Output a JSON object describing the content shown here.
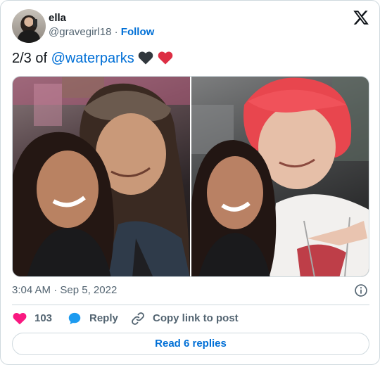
{
  "author": {
    "name": "ella",
    "handle": "@gravegirl18",
    "separator": "·",
    "follow_label": "Follow"
  },
  "brand_icon": "x-logo-icon",
  "tweet": {
    "text_prefix": "2/3 of ",
    "mention": "@waterparks",
    "emojis": [
      "black-heart-icon",
      "red-heart-icon"
    ]
  },
  "media": {
    "photos": [
      {
        "description_icon": "photo-left"
      },
      {
        "description_icon": "photo-right"
      }
    ]
  },
  "meta": {
    "time": "3:04 AM",
    "separator": "·",
    "date": "Sep 5, 2022"
  },
  "actions": {
    "like_count": "103",
    "reply_label": "Reply",
    "copy_label": "Copy link to post"
  },
  "read_replies_label": "Read 6 replies",
  "colors": {
    "link": "#006fd6",
    "like": "#f91880",
    "reply": "#1d9bf0",
    "muted": "#536471",
    "border": "#cfd9de"
  }
}
